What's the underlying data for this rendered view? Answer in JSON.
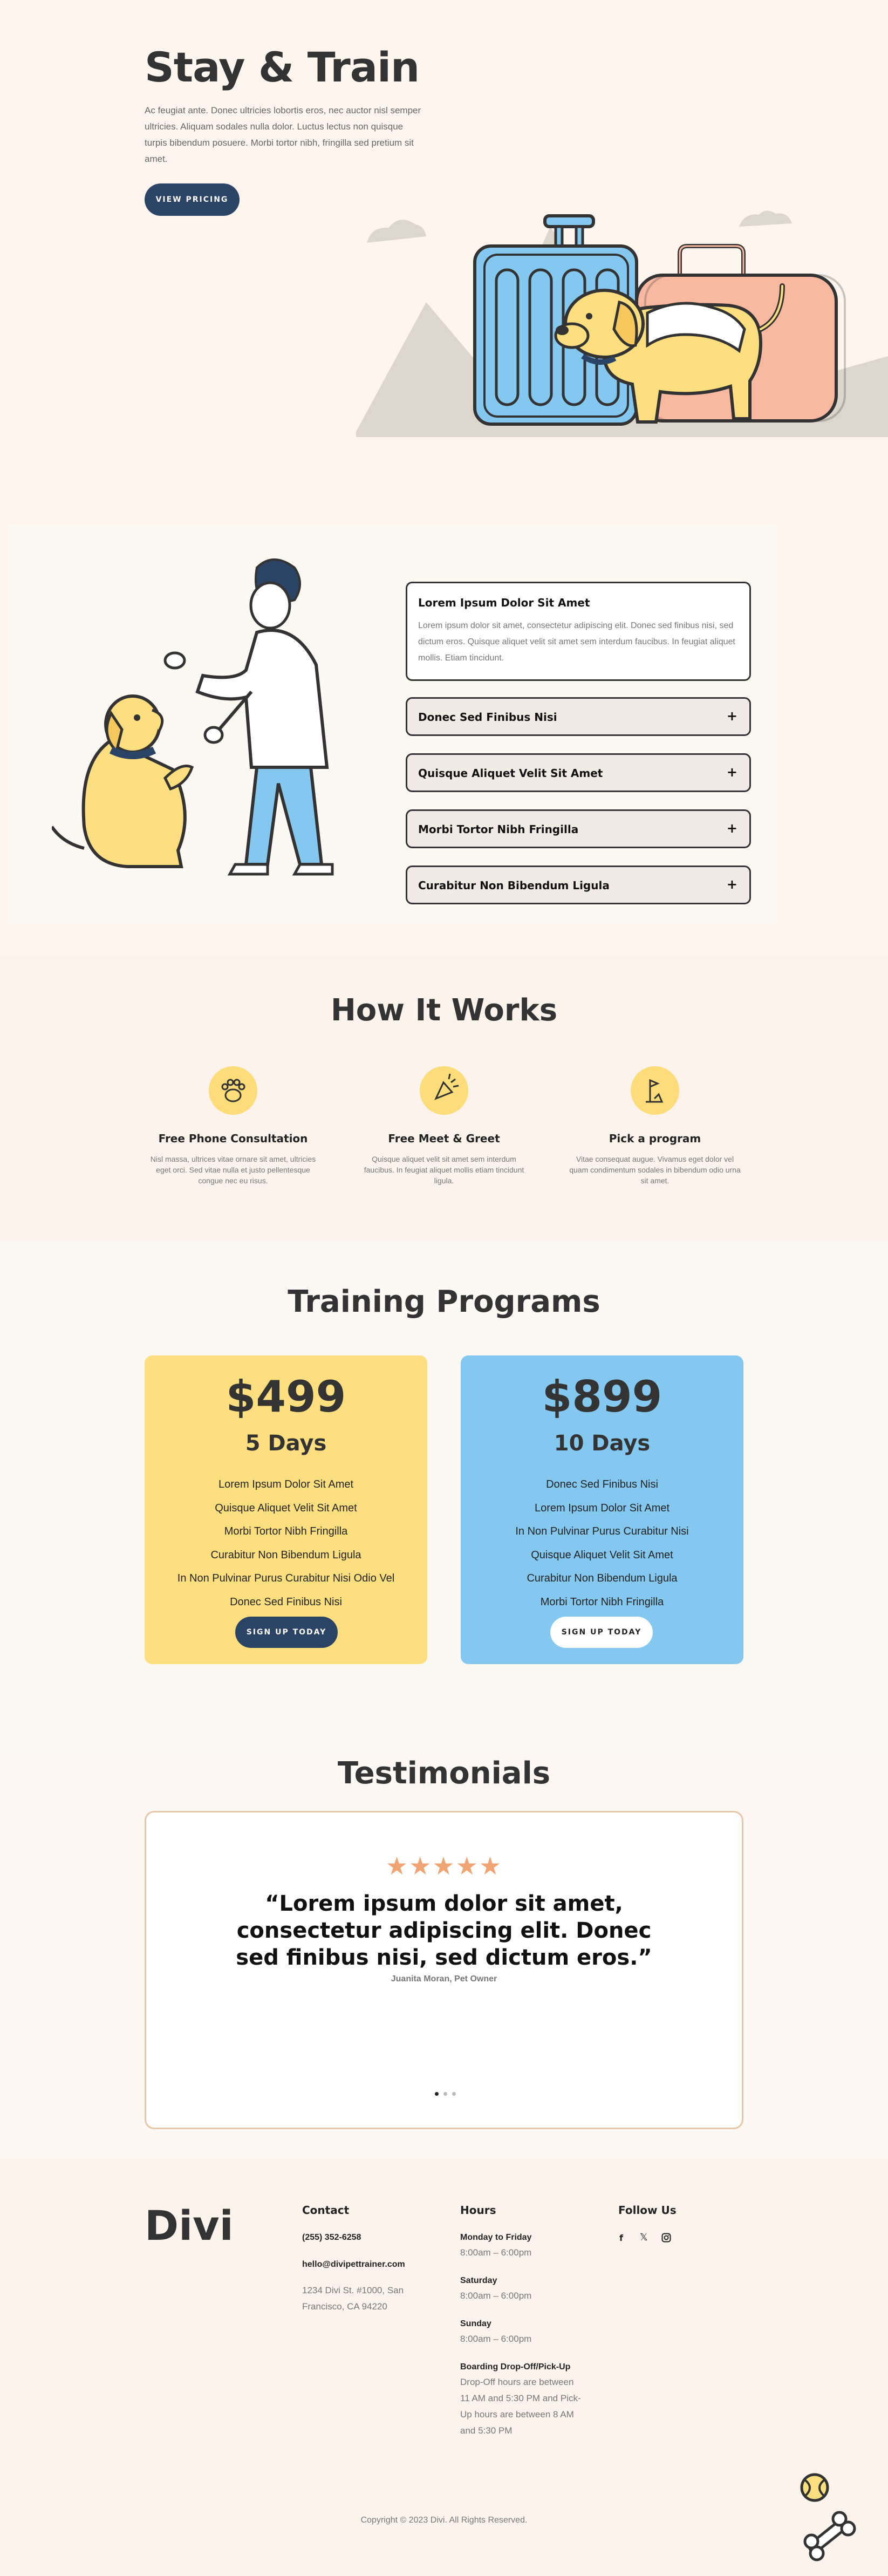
{
  "hero": {
    "title": "Stay & Train",
    "text": "Ac feugiat ante. Donec ultricies lobortis eros, nec auctor nisl semper ultricies. Aliquam sodales nulla dolor. Luctus lectus non quisque turpis bibendum posuere. Morbi tortor nibh, fringilla sed pretium sit amet.",
    "button": "VIEW PRICING"
  },
  "faq": {
    "open_item": {
      "title": "Lorem Ipsum Dolor Sit Amet",
      "text": "Lorem ipsum dolor sit amet, consectetur adipiscing elit. Donec sed finibus nisi, sed dictum eros. Quisque aliquet velit sit amet sem interdum faucibus. In feugiat aliquet mollis. Etiam tincidunt."
    },
    "items": [
      {
        "title": "Donec Sed Finibus Nisi",
        "icon": "+"
      },
      {
        "title": "Quisque Aliquet Velit Sit Amet",
        "icon": "+"
      },
      {
        "title": "Morbi Tortor Nibh Fringilla",
        "icon": "+"
      },
      {
        "title": "Curabitur Non Bibendum Ligula",
        "icon": "+"
      }
    ]
  },
  "how": {
    "title": "How It Works",
    "steps": [
      {
        "icon": "paw-icon",
        "title": "Free Phone Consultation",
        "text": "Nisl massa, ultrices vitae ornare sit amet, ultricies eget orci. Sed vitae nulla et justo pellentesque congue nec eu risus."
      },
      {
        "icon": "treat-icon",
        "title": "Free Meet & Greet",
        "text": "Quisque aliquet velit sit amet sem interdum faucibus. In feugiat aliquet mollis etiam tincidunt ligula."
      },
      {
        "icon": "flag-icon",
        "title": "Pick a program",
        "text": "Vitae consequat augue. Vivamus eget dolor vel quam condimentum sodales in bibendum odio urna sit amet."
      }
    ]
  },
  "pricing": {
    "title": "Training Programs",
    "plans": [
      {
        "price": "$499",
        "duration": "5 Days",
        "features": [
          "Lorem Ipsum Dolor Sit Amet",
          "Quisque Aliquet Velit Sit Amet",
          "Morbi Tortor Nibh Fringilla",
          "Curabitur Non Bibendum Ligula",
          "In Non Pulvinar Purus Curabitur Nisi Odio Vel",
          "Donec Sed Finibus Nisi"
        ],
        "button": "SIGN UP TODAY",
        "color": "#fedf7f"
      },
      {
        "price": "$899",
        "duration": "10 Days",
        "features": [
          "Donec Sed Finibus Nisi",
          "Lorem Ipsum Dolor Sit Amet",
          "In Non Pulvinar Purus Curabitur Nisi",
          "Quisque Aliquet Velit Sit Amet",
          "Curabitur Non Bibendum Ligula",
          "Morbi Tortor Nibh Fringilla"
        ],
        "button": "SIGN UP TODAY",
        "color": "#84c8f0"
      }
    ]
  },
  "testimonials": {
    "title": "Testimonials",
    "stars": "★★★★★",
    "rating": 5,
    "quote": "“Lorem ipsum dolor sit amet, consectetur adipiscing elit. Donec sed finibus nisi, sed dictum eros.”",
    "author": "Juanita Moran, Pet Owner",
    "slide_count": 3,
    "active_slide": 1
  },
  "footer": {
    "logo": "Divi",
    "contact": {
      "heading": "Contact",
      "phone": "(255) 352-6258",
      "email": "hello@divipettrainer.com",
      "address": "1234 Divi St. #1000, San Francisco, CA 94220"
    },
    "hours": {
      "heading": "Hours",
      "rows": [
        {
          "label": "Monday to Friday",
          "value": "8:00am – 6:00pm"
        },
        {
          "label": "Saturday",
          "value": "8:00am – 6:00pm"
        },
        {
          "label": "Sunday",
          "value": "8:00am – 6:00pm"
        },
        {
          "label": "Boarding Drop-Off/Pick-Up",
          "value": "Drop-Off hours are between 11 AM and 5:30 PM and Pick-Up hours are between 8 AM and 5:30 PM"
        }
      ]
    },
    "follow": {
      "heading": "Follow Us",
      "icons": [
        "facebook-icon",
        "x-icon",
        "instagram-icon"
      ]
    },
    "copyright": "Copyright © 2023 Divi. All Rights Reserved."
  },
  "colors": {
    "navy": "#2b4364",
    "yellow": "#fedf7f",
    "blue": "#84c8f0",
    "salmon": "#f9b9a0",
    "star": "#f0a474"
  }
}
